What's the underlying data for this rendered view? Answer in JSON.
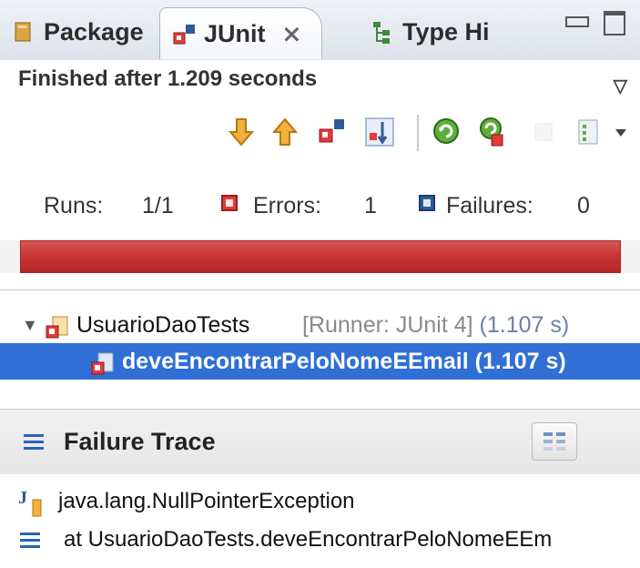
{
  "tabs": [
    {
      "label": "Package",
      "icon": "package-explorer-icon"
    },
    {
      "label": "JUnit",
      "icon": "junit-icon",
      "active": true,
      "close_glyph": "⨯"
    },
    {
      "label": "Type Hi",
      "icon": "type-hierarchy-icon"
    }
  ],
  "window_controls": [
    "minimize",
    "maximize"
  ],
  "status": "Finished after 1.209 seconds",
  "toolbar": [
    "next-failure-icon",
    "previous-failure-icon",
    "show-failures-only-icon",
    "scroll-lock-icon",
    "rerun-test-icon",
    "rerun-failed-first-icon",
    "stop-icon",
    "history-icon",
    "view-menu-icon"
  ],
  "counters": {
    "runs_label": "Runs:",
    "runs_value": "1/1",
    "errors_label": "Errors:",
    "errors_value": "1",
    "failures_label": "Failures:",
    "failures_value": "0"
  },
  "progress": {
    "fraction": 1.0,
    "color": "#c83535"
  },
  "tree": {
    "suite": {
      "name": "UsuarioDaoTests",
      "runner": "[Runner: JUnit 4]",
      "time": "(1.107 s)"
    },
    "test": {
      "name": "deveEncontrarPeloNomeEEmail (1.107 s)",
      "selected": true
    }
  },
  "trace": {
    "title": "Failure Trace",
    "lines": [
      "java.lang.NullPointerException",
      "at UsuarioDaoTests.deveEncontrarPeloNomeEEm"
    ]
  },
  "colors": {
    "selection": "#2f6fd6",
    "error_bar": "#c83535"
  }
}
